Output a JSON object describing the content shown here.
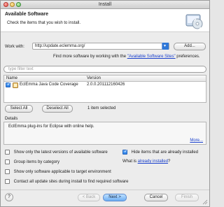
{
  "window": {
    "title": "Install"
  },
  "header": {
    "title": "Available Software",
    "description": "Check the items that you wish to install."
  },
  "work_with": {
    "label": "Work with:",
    "value": "http://update.eclemma.org/",
    "add_label": "Add..."
  },
  "find_more": {
    "prefix": "Find more software by working with the ",
    "link": "\"Available Software Sites\"",
    "suffix": " preferences."
  },
  "filter": {
    "placeholder": "type filter text"
  },
  "table": {
    "headers": [
      "Name",
      "Version"
    ],
    "rows": [
      {
        "name": "EclEmma Java Code Coverage",
        "version": "2.0.0.201112160426",
        "checked": true
      }
    ]
  },
  "selection": {
    "select_all": "Select All",
    "deselect_all": "Deselect All",
    "status": "1 item selected"
  },
  "details": {
    "label": "Details",
    "text": "EclEmma plug-ins for Eclipse with online help.",
    "more": "More..."
  },
  "options": {
    "latest_versions": "Show only the latest versions of available software",
    "hide_installed": "Hide items that are already installed",
    "group_by_category": "Group items by category",
    "what_is_prefix": "What is ",
    "what_is_link": "already installed",
    "what_is_suffix": "?",
    "target_env": "Show only software applicable to target environment",
    "contact_sites": "Contact all update sites during install to find required software"
  },
  "footer": {
    "help": "?",
    "back": "< Back",
    "next": "Next >",
    "cancel": "Cancel",
    "finish": "Finish"
  }
}
